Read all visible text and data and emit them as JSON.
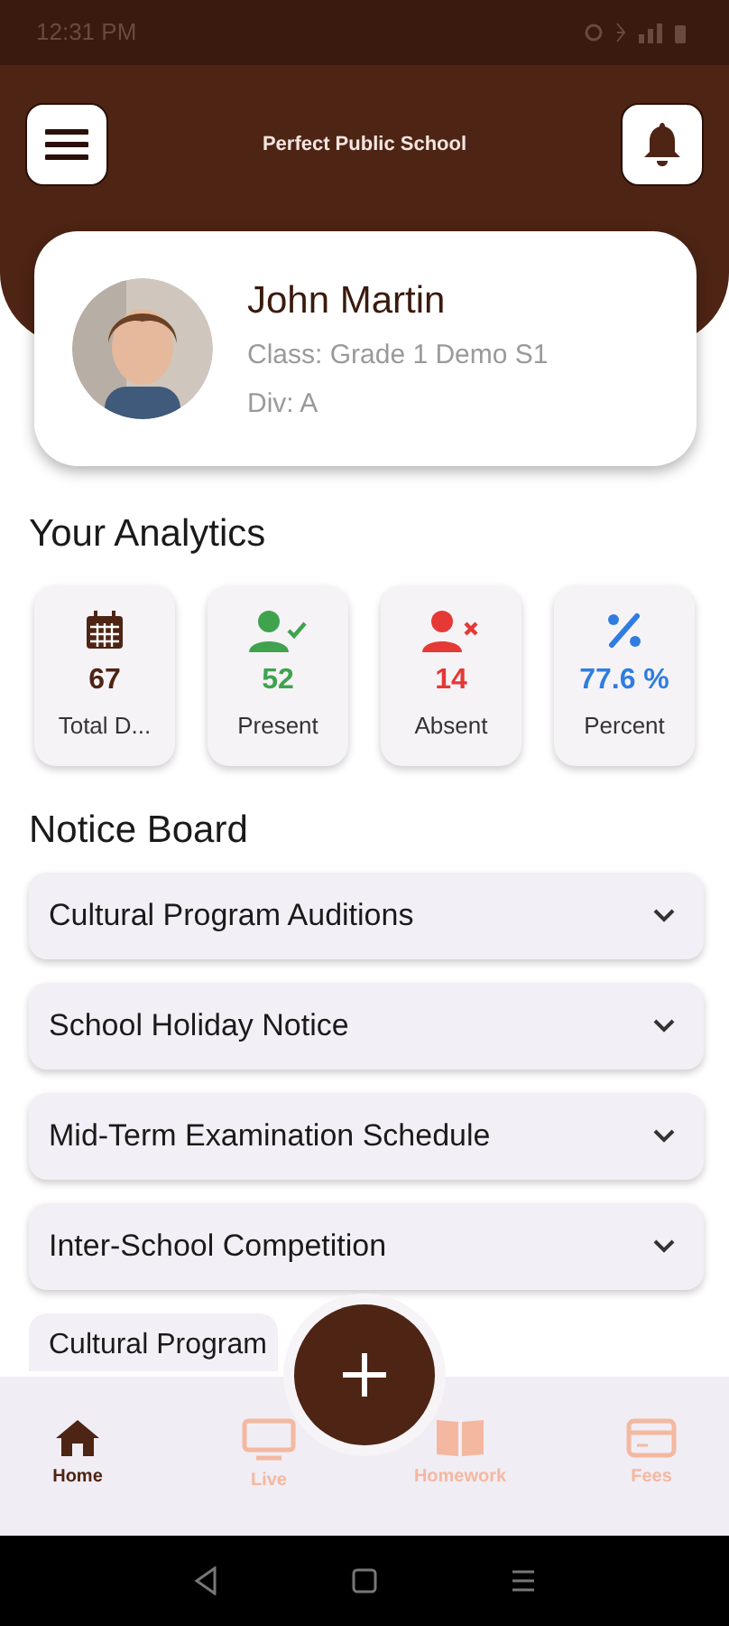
{
  "status_bar": {
    "time": "12:31 PM"
  },
  "header": {
    "title": "Perfect Public School"
  },
  "profile": {
    "name": "John Martin",
    "class": "Class: Grade 1 Demo S1",
    "division": "Div: A"
  },
  "analytics": {
    "title": "Your Analytics",
    "stats": [
      {
        "kind": "calendar",
        "value": "67",
        "label": "Total D...",
        "color": "#4e2414"
      },
      {
        "kind": "present",
        "value": "52",
        "label": "Present",
        "color": "#3fa34d"
      },
      {
        "kind": "absent",
        "value": "14",
        "label": "Absent",
        "color": "#e53935"
      },
      {
        "kind": "percent",
        "value": "77.6 %",
        "label": "Percent",
        "color": "#2f7de1"
      }
    ]
  },
  "notice_board": {
    "title": "Notice Board",
    "notices": [
      {
        "title": "Cultural Program Auditions",
        "expanded": false
      },
      {
        "title": "School Holiday Notice",
        "expanded": false
      },
      {
        "title": "Mid-Term Examination Schedule",
        "expanded": false
      },
      {
        "title": "Inter-School Competition",
        "expanded": false
      },
      {
        "title": "Cultural Program",
        "cut_off": true
      }
    ]
  },
  "bottom_nav": {
    "items": [
      {
        "kind": "home",
        "label": "Home",
        "selected": true
      },
      {
        "kind": "live",
        "label": "Live",
        "selected": false
      },
      {
        "kind": "homework",
        "label": "Homework",
        "selected": false
      },
      {
        "kind": "fees",
        "label": "Fees",
        "selected": false
      }
    ]
  }
}
